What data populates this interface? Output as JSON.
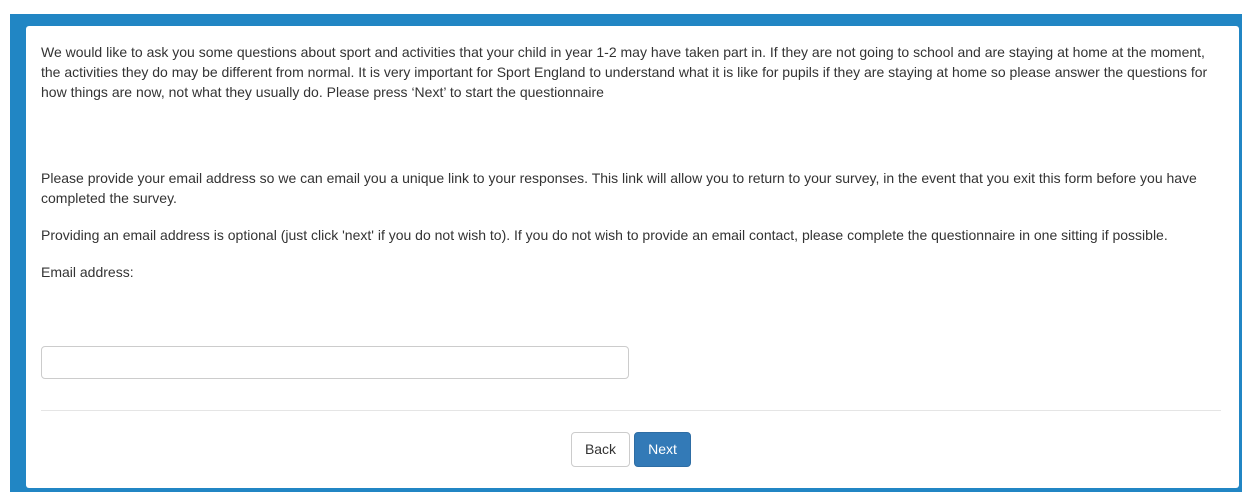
{
  "survey": {
    "intro_text": "We would like to ask you some questions about sport and activities that your child in year 1-2 may have taken part in. If they are not going to school and are staying at home at the moment, the activities they do may be different from normal. It is very important for Sport England to understand what it is like for pupils if they are staying at home so please answer the questions for how things are now, not what they usually do. Please press ‘Next’ to start the questionnaire",
    "email_info_text": "Please provide your email address so we can email you a unique link to your responses. This link will allow you to return to your survey, in the event that you exit this form before you have completed the survey.",
    "optional_info_text": "Providing an email address is optional (just click 'next' if you do not wish to). If you do not wish to provide an email contact, please complete the questionnaire in one sitting if possible.",
    "email_label": "Email address:",
    "email_value": "",
    "email_placeholder": ""
  },
  "navigation": {
    "back_label": "Back",
    "next_label": "Next"
  },
  "colors": {
    "frame": "#2186c4",
    "primary_button": "#337ab7"
  }
}
